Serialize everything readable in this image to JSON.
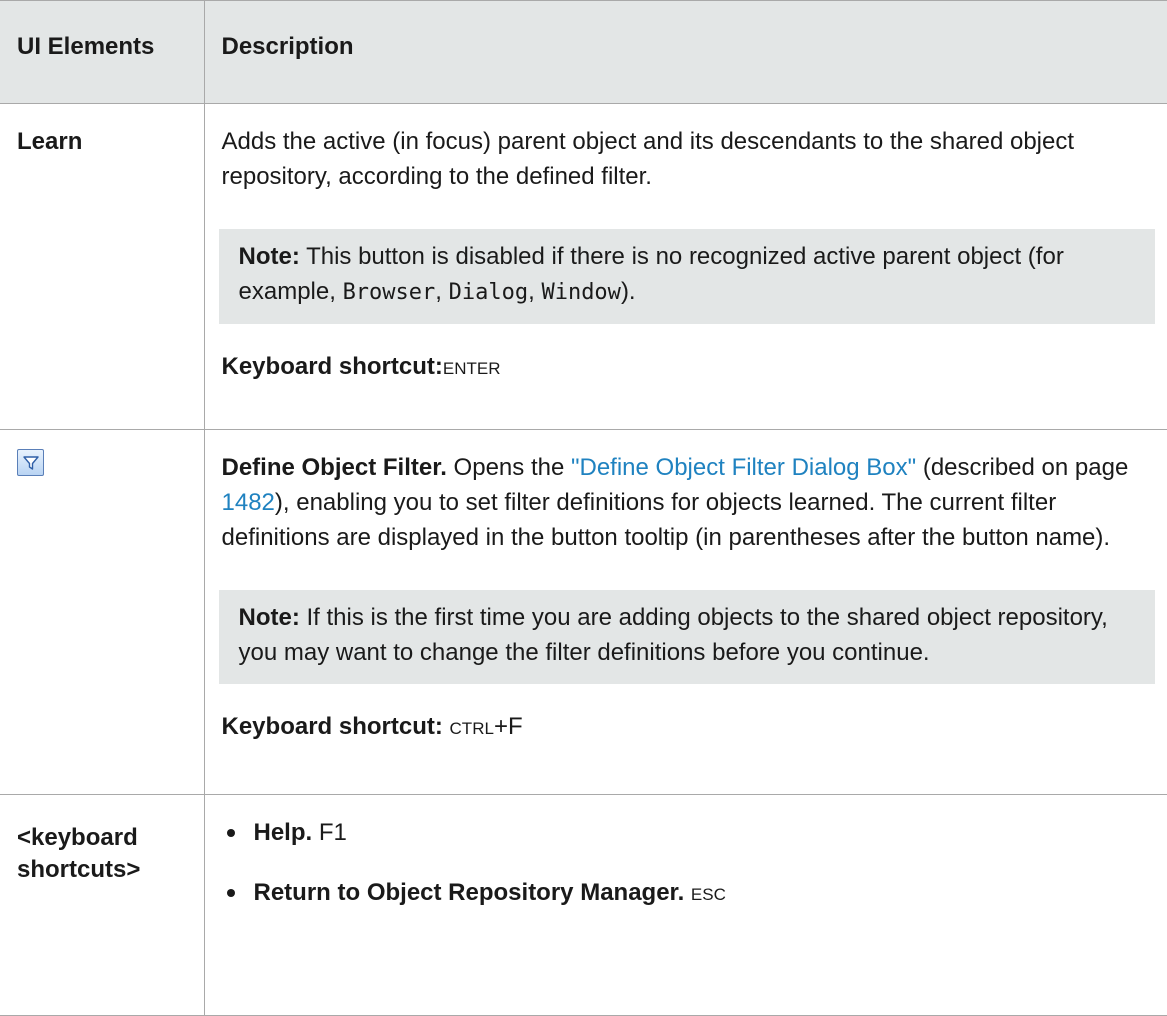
{
  "header": {
    "col1": "UI Elements",
    "col2": "Description"
  },
  "rows": [
    {
      "element": "Learn",
      "description": "Adds the active (in focus) parent object and its descendants to the shared object repository, according to the defined filter.",
      "note": {
        "label": "Note:",
        "text_before": " This button is disabled if there is no recognized active parent object (for example, ",
        "code1": "Browser",
        "sep1": ", ",
        "code2": "Dialog",
        "sep2": ", ",
        "code3": "Window",
        "text_after": ")."
      },
      "shortcut_label": "Keyboard shortcut:",
      "shortcut_value": "Enter"
    },
    {
      "element_icon": "filter-icon",
      "title": "Define Object Filter.",
      "text1": " Opens the ",
      "link_text": "\"Define Object Filter Dialog Box\"",
      "text2": " (described on page ",
      "page_link": "1482",
      "text3": "), enabling you to set filter definitions for objects learned. The current filter definitions are displayed in the button tooltip (in parentheses after the button name).",
      "note": {
        "label": "Note:",
        "text": " If this is the first time you are adding objects to the shared object repository, you may want to change the filter definitions before you continue."
      },
      "shortcut_label": "Keyboard shortcut:",
      "shortcut_value_key": "Ctrl",
      "shortcut_value_rest": "+F"
    },
    {
      "element": "<keyboard shortcuts>",
      "items": [
        {
          "label": "Help.",
          "value": "F1"
        },
        {
          "label": "Return to Object Repository Manager.",
          "value": "Esc"
        }
      ]
    }
  ],
  "colors": {
    "header_bg": "#e3e6e6",
    "note_bg": "#e3e6e6",
    "border": "#a9a9a9",
    "link": "#1f82c0"
  }
}
